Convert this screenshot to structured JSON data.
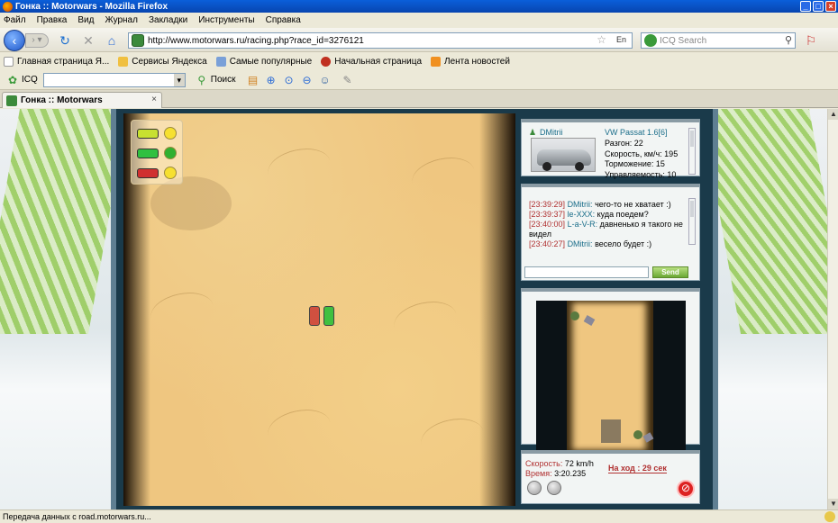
{
  "window": {
    "title": "Гонка :: Motorwars - Mozilla Firefox"
  },
  "menu": [
    "Файл",
    "Правка",
    "Вид",
    "Журнал",
    "Закладки",
    "Инструменты",
    "Справка"
  ],
  "nav": {
    "url": "http://www.motorwars.ru/racing.php?race_id=3276121",
    "lang": "En",
    "search_placeholder": "ICQ Search"
  },
  "bookmarks": [
    "Главная страница Я...",
    "Сервисы Яндекса",
    "Самые популярные",
    "Начальная страница",
    "Лента новостей"
  ],
  "icq": {
    "label": "ICQ",
    "search_label": "Поиск"
  },
  "tab": {
    "title": "Гонка :: Motorwars",
    "close": "×"
  },
  "car": {
    "user": "DMitrii",
    "model": "VW Passat 1.6[6]",
    "stats": [
      "Разгон: 22",
      "Скорость, км/ч: 195",
      "Торможение: 15",
      "Управляемость: 10"
    ]
  },
  "chat": {
    "messages": [
      {
        "time": "[23:39:29]",
        "nick": "DMitrii:",
        "text": "чего-то не хватает :)"
      },
      {
        "time": "[23:39:37]",
        "nick": "le-XXX:",
        "text": "куда поедем?"
      },
      {
        "time": "[23:40:00]",
        "nick": "L-a-V-R:",
        "text": "давненько я такого не видел"
      },
      {
        "time": "[23:40:27]",
        "nick": "DMitrii:",
        "text": "весело будет :)"
      }
    ],
    "send_label": "Send"
  },
  "race": {
    "speed_label": "Скорость:",
    "speed_value": "72 km/h",
    "time_label": "Время:",
    "time_value": "3:20.235",
    "turn_label": "На ход :",
    "turn_value": "29 сек"
  },
  "status": "Передача данных с road.motorwars.ru...",
  "colors": {
    "sand": "#efc680",
    "accent": "#1b6e8a",
    "alert": "#b03030"
  }
}
